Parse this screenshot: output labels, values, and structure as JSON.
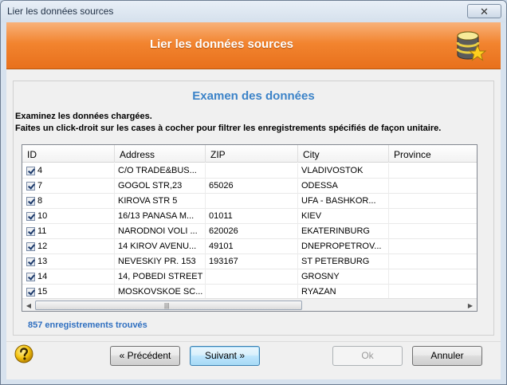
{
  "window": {
    "title": "Lier les données sources",
    "close_glyph": "✕"
  },
  "banner": {
    "title": "Lier les données sources",
    "icon": "database-star-icon"
  },
  "section": {
    "title": "Examen des données",
    "line1": "Examinez les données chargées.",
    "line2": "Faites un click-droit sur les cases à cocher pour filtrer les enregistrements spécifiés de façon unitaire."
  },
  "grid": {
    "columns": [
      "ID",
      "Address",
      "ZIP",
      "City",
      "Province"
    ],
    "rows": [
      {
        "id": "4",
        "address": "C/O TRADE&BUS...",
        "zip": "",
        "city": "VLADIVOSTOK",
        "province": ""
      },
      {
        "id": "7",
        "address": "GOGOL STR,23",
        "zip": "65026",
        "city": "ODESSA",
        "province": ""
      },
      {
        "id": "8",
        "address": "KIROVA STR 5",
        "zip": "",
        "city": "UFA  - BASHKOR...",
        "province": ""
      },
      {
        "id": "10",
        "address": "16/13 PANASA M...",
        "zip": "01011",
        "city": "KIEV",
        "province": ""
      },
      {
        "id": "11",
        "address": "NARODNOI VOLI ...",
        "zip": "620026",
        "city": "EKATERINBURG",
        "province": ""
      },
      {
        "id": "12",
        "address": "14 KIROV AVENU...",
        "zip": "49101",
        "city": "DNEPROPETROV...",
        "province": ""
      },
      {
        "id": "13",
        "address": "NEVESKIY  PR. 153",
        "zip": "193167",
        "city": "ST PETERBURG",
        "province": ""
      },
      {
        "id": "14",
        "address": "14, POBEDI STREET",
        "zip": "",
        "city": "GROSNY",
        "province": ""
      },
      {
        "id": "15",
        "address": "MOSKOVSKOE SC...",
        "zip": "",
        "city": "RYAZAN",
        "province": ""
      }
    ],
    "scroll_left": "◀",
    "scroll_right": "▶",
    "scroll_grip": "|||"
  },
  "status": {
    "count": "857",
    "count_label": " enregistrements trouvés"
  },
  "buttons": {
    "previous": "« Précédent",
    "next": "Suivant »",
    "ok": "Ok",
    "cancel": "Annuler"
  },
  "colors": {
    "accent": "#3c83c8",
    "banner": "#f2842f"
  }
}
